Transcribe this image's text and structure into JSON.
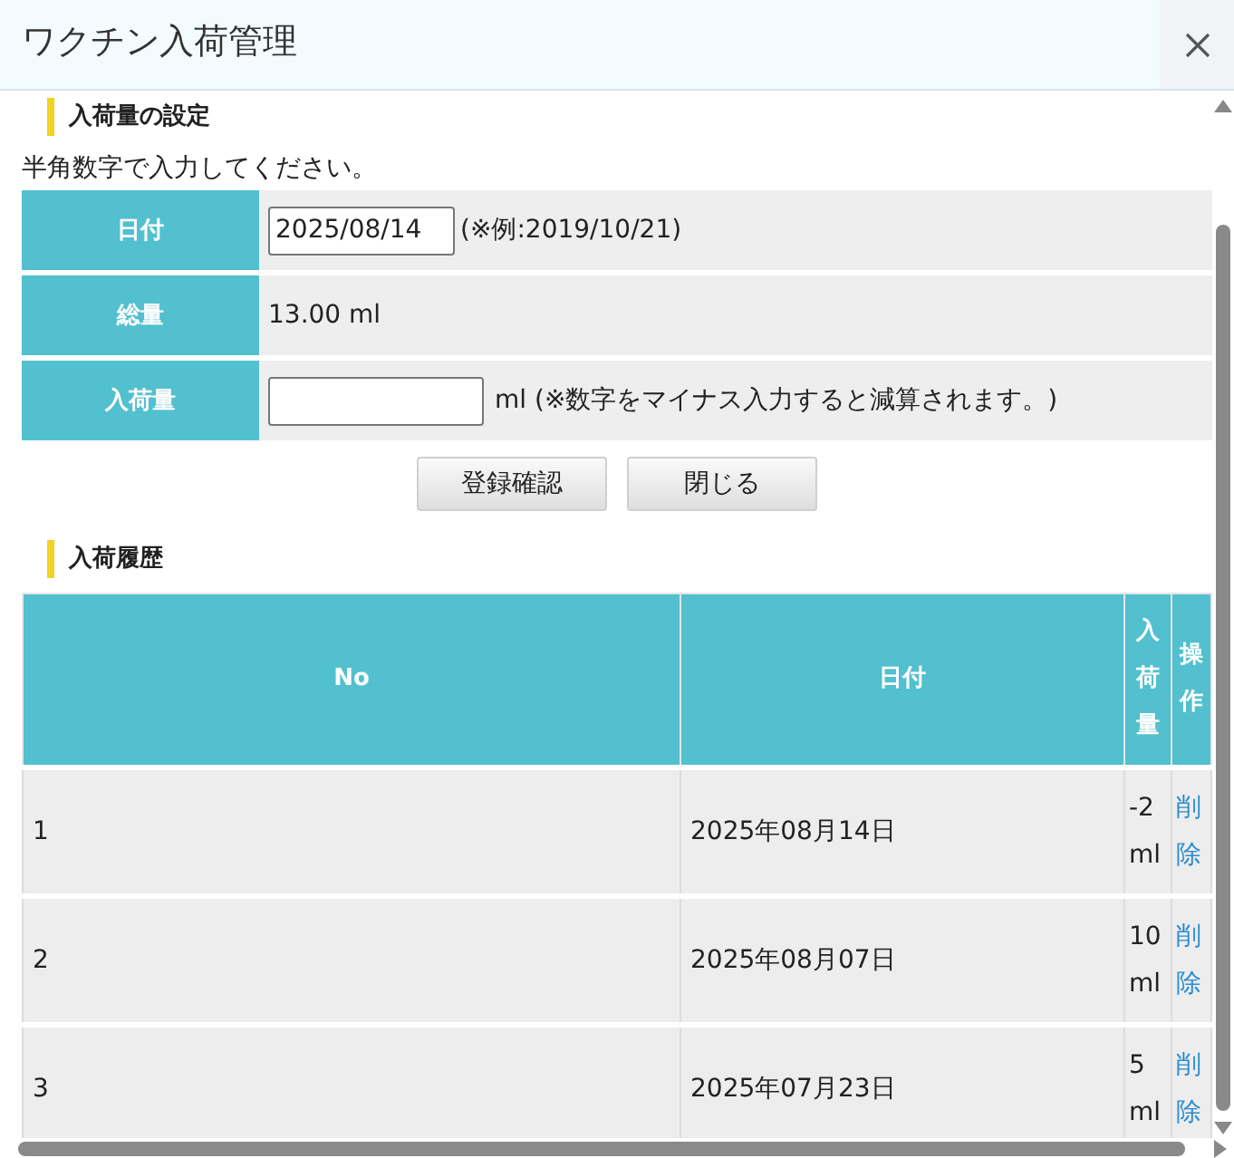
{
  "dialog": {
    "title": "ワクチン入荷管理"
  },
  "settings": {
    "heading": "入荷量の設定",
    "note": "半角数字で入力してください。",
    "rows": [
      {
        "kind": "date",
        "label": "日付",
        "value": "2025/08/14",
        "hint": "(※例:2019/10/21)"
      },
      {
        "kind": "text",
        "label": "総量",
        "value": "13.00 ml"
      },
      {
        "kind": "amount",
        "label": "入荷量",
        "unit": "ml (※数字をマイナス入力すると減算されます。)"
      }
    ]
  },
  "buttons": [
    "登録確認",
    "閉じる"
  ],
  "history": {
    "heading": "入荷履歴",
    "columns": [
      "No",
      "日付",
      "入荷量",
      "操作"
    ],
    "rows": [
      {
        "no": "1",
        "date": "2025年08月14日",
        "amount": "-2 ml",
        "action": "削除"
      },
      {
        "no": "2",
        "date": "2025年08月07日",
        "amount": "10 ml",
        "action": "削除"
      },
      {
        "no": "3",
        "date": "2025年07月23日",
        "amount": "5 ml",
        "action": "削除"
      }
    ]
  }
}
